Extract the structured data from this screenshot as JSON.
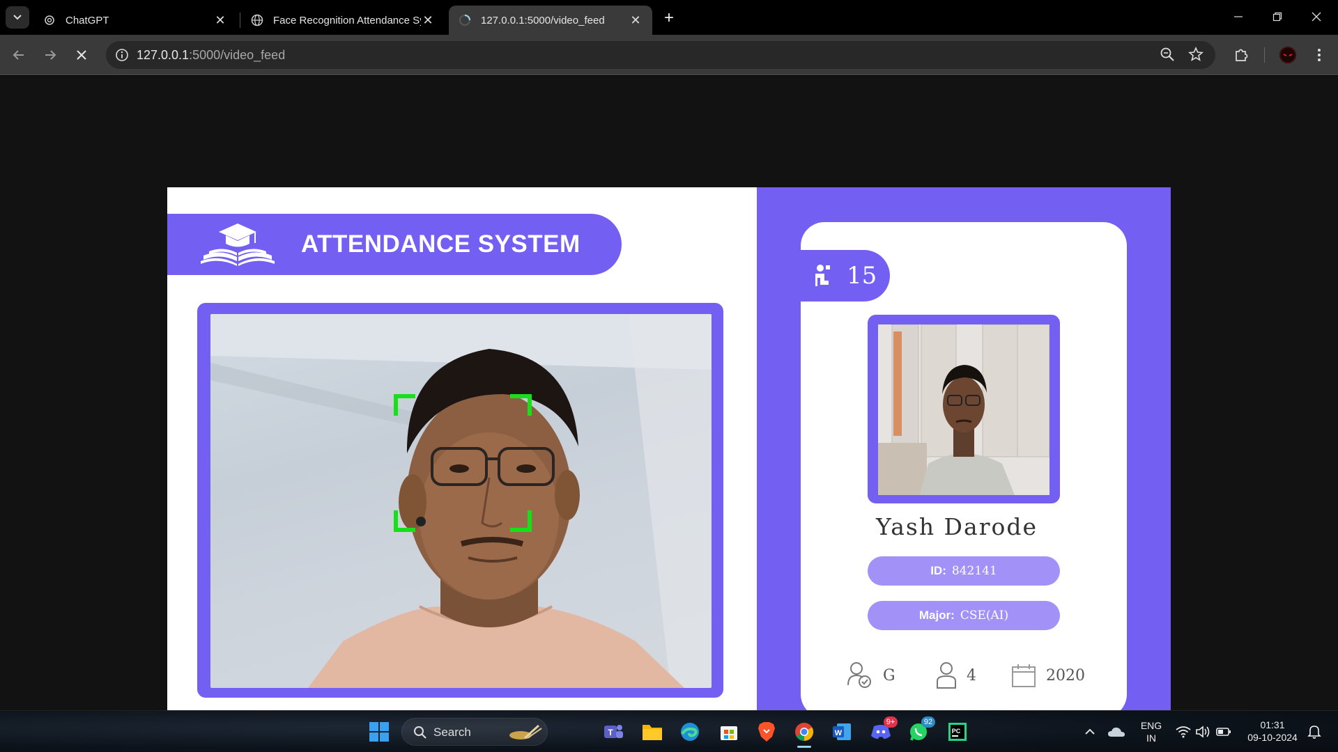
{
  "browser": {
    "tabs": [
      {
        "title": "ChatGPT",
        "active": false
      },
      {
        "title": "Face Recognition Attendance Sy",
        "active": false
      },
      {
        "title": "127.0.0.1:5000/video_feed",
        "active": true
      }
    ],
    "url_host": "127.0.0.1",
    "url_rest": ":5000/video_feed"
  },
  "app": {
    "banner_title": "ATTENDANCE SYSTEM",
    "accent_color": "#7360f2",
    "detection_color": "#18e018",
    "attendance_count": "15",
    "student": {
      "name": "Yash Darode",
      "id_label": "ID:",
      "id_value": "842141",
      "major_label": "Major:",
      "major_value": "CSE(AI)",
      "standing": "G",
      "year": "4",
      "starting_year": "2020"
    }
  },
  "taskbar": {
    "search_label": "Search",
    "discord_badge": "9+",
    "whatsapp_badge": "92",
    "lang_primary": "ENG",
    "lang_secondary": "IN",
    "time": "01:31",
    "date": "09-10-2024"
  }
}
